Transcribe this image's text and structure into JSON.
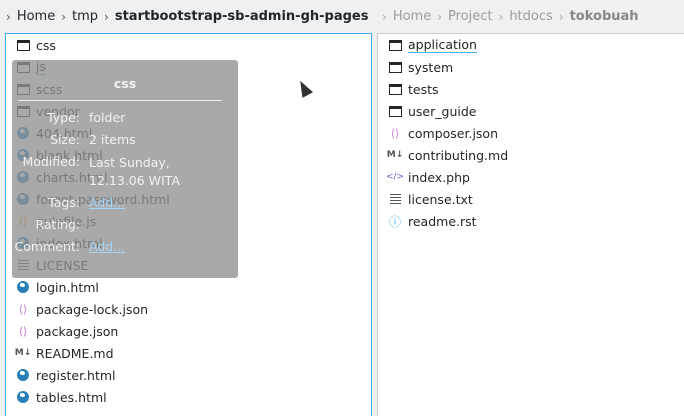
{
  "left_breadcrumb": [
    "Home",
    "tmp",
    "startbootstrap-sb-admin-gh-pages"
  ],
  "right_breadcrumb": [
    "Home",
    "Project",
    "htdocs",
    "tokobuah"
  ],
  "left_files": [
    {
      "name": "css",
      "icon": "folder-icon"
    },
    {
      "name": "js",
      "icon": "folder-icon"
    },
    {
      "name": "scss",
      "icon": "folder-icon"
    },
    {
      "name": "vendor",
      "icon": "folder-icon"
    },
    {
      "name": "404.html",
      "icon": "globe-icon"
    },
    {
      "name": "blank.html",
      "icon": "globe-icon"
    },
    {
      "name": "charts.html",
      "icon": "globe-icon"
    },
    {
      "name": "forgot-password.html",
      "icon": "globe-icon"
    },
    {
      "name": "gulpfile.js",
      "icon": "js-icon"
    },
    {
      "name": "index.html",
      "icon": "globe-icon"
    },
    {
      "name": "LICENSE",
      "icon": "text-icon"
    },
    {
      "name": "login.html",
      "icon": "globe-icon"
    },
    {
      "name": "package-lock.json",
      "icon": "json-icon"
    },
    {
      "name": "package.json",
      "icon": "json-icon"
    },
    {
      "name": "README.md",
      "icon": "markdown-icon"
    },
    {
      "name": "register.html",
      "icon": "globe-icon"
    },
    {
      "name": "tables.html",
      "icon": "globe-icon"
    }
  ],
  "right_files": [
    {
      "name": "application",
      "icon": "folder-icon"
    },
    {
      "name": "system",
      "icon": "folder-icon"
    },
    {
      "name": "tests",
      "icon": "folder-icon"
    },
    {
      "name": "user_guide",
      "icon": "folder-icon"
    },
    {
      "name": "composer.json",
      "icon": "json-icon"
    },
    {
      "name": "contributing.md",
      "icon": "markdown-icon"
    },
    {
      "name": "index.php",
      "icon": "php-icon"
    },
    {
      "name": "license.txt",
      "icon": "text-icon"
    },
    {
      "name": "readme.rst",
      "icon": "info-icon"
    }
  ],
  "tooltip": {
    "title": "css",
    "type_label": "Type:",
    "type_value": "folder",
    "size_label": "Size:",
    "size_value": "2 items",
    "modified_label": "Modified:",
    "modified_value": "Last Sunday, 12.13.06 WITA",
    "tags_label": "Tags:",
    "tags_value": "Add...",
    "rating_label": "Rating:",
    "comment_label": "Comment:",
    "comment_value": "Add..."
  },
  "accent": "#3daee9"
}
